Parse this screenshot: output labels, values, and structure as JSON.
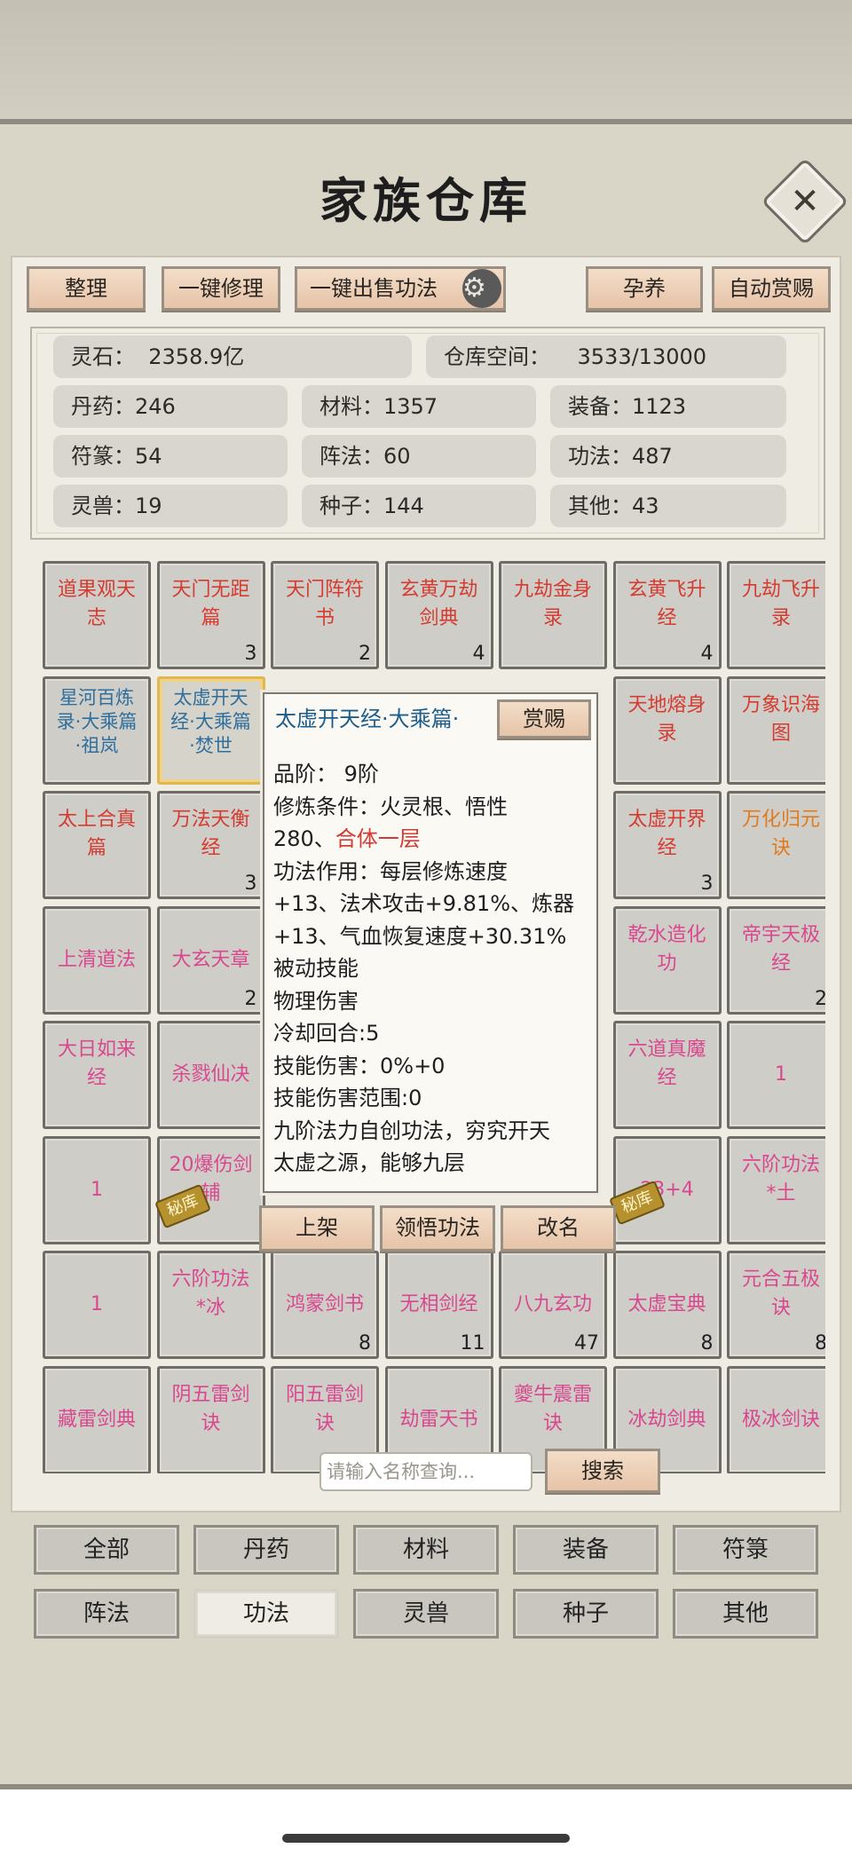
{
  "title": "家族仓库",
  "toolbar": {
    "sort": "整理",
    "repair": "一键修理",
    "sell": "一键出售功法",
    "nurture": "孕养",
    "auto_reward": "自动赏赐"
  },
  "stats": {
    "spirit_stone": "灵石：  2358.9亿",
    "space": "仓库空间：    3533/13000",
    "pills": "丹药：246",
    "materials": "材料：1357",
    "equipment": "装备：1123",
    "talismans": "符篆：54",
    "formations": "阵法：60",
    "techniques": "功法：487",
    "beasts": "灵兽：19",
    "seeds": "种子：144",
    "others": "其他：43"
  },
  "grid": [
    {
      "name": "道果观天\n志",
      "count": "",
      "color": "#d53b30"
    },
    {
      "name": "天门无距\n篇",
      "count": "3",
      "color": "#d53b30"
    },
    {
      "name": "天门阵符\n书",
      "count": "2",
      "color": "#d53b30"
    },
    {
      "name": "玄黄万劫\n剑典",
      "count": "4",
      "color": "#d53b30"
    },
    {
      "name": "九劫金身\n录",
      "count": "",
      "color": "#d53b30"
    },
    {
      "name": "玄黄飞升\n经",
      "count": "4",
      "color": "#d53b30"
    },
    {
      "name": "九劫飞升\n录",
      "count": "",
      "color": "#d53b30"
    },
    {
      "name": "星河百炼\n录·大乘篇\n·祖岚",
      "count": "",
      "color": "#2f6f9e",
      "small": true
    },
    {
      "name": "太虚开天\n经·大乘篇\n·焚世",
      "count": "",
      "color": "#2f6f9e",
      "small": true,
      "selected": true
    },
    null,
    null,
    null,
    {
      "name": "天地熔身\n录",
      "count": "",
      "color": "#d53b30"
    },
    {
      "name": "万象识海\n图",
      "count": "",
      "color": "#d53b30"
    },
    {
      "name": "太上合真\n篇",
      "count": "",
      "color": "#d53b30"
    },
    {
      "name": "万法天衡\n经",
      "count": "3",
      "color": "#d53b30"
    },
    null,
    null,
    null,
    {
      "name": "太虚开界\n经",
      "count": "3",
      "color": "#d53b30"
    },
    {
      "name": "万化归元\n诀",
      "count": "",
      "color": "#e07a1f"
    },
    {
      "name": "上清道法",
      "count": "",
      "color": "#d9488e"
    },
    {
      "name": "大玄天章",
      "count": "2",
      "color": "#d9488e"
    },
    null,
    null,
    null,
    {
      "name": "乾水造化\n功",
      "count": "",
      "color": "#d9488e"
    },
    {
      "name": "帝宇天极\n经",
      "count": "2",
      "color": "#d9488e"
    },
    {
      "name": "大日如来\n经",
      "count": "",
      "color": "#d9488e"
    },
    {
      "name": "杀戮仙决",
      "count": "",
      "color": "#d9488e"
    },
    null,
    null,
    null,
    {
      "name": "六道真魔\n经",
      "count": "",
      "color": "#d9488e"
    },
    {
      "name": "1",
      "count": "",
      "color": "#d9488e"
    },
    {
      "name": "1",
      "count": "",
      "color": "#d9488e"
    },
    {
      "name": "20爆伤剑\n辅",
      "count": "",
      "color": "#d9488e",
      "seal": true
    },
    null,
    null,
    null,
    {
      "name": "23+4",
      "count": "",
      "color": "#d9488e",
      "seal": true
    },
    {
      "name": "六阶功法\n*土",
      "count": "",
      "color": "#d9488e"
    },
    {
      "name": "1",
      "count": "",
      "color": "#d9488e"
    },
    {
      "name": "六阶功法\n*冰",
      "count": "",
      "color": "#d9488e"
    },
    {
      "name": "鸿蒙剑书",
      "count": "8",
      "color": "#d9488e"
    },
    {
      "name": "无相剑经",
      "count": "11",
      "color": "#d9488e"
    },
    {
      "name": "八九玄功",
      "count": "47",
      "color": "#d9488e"
    },
    {
      "name": "太虚宝典",
      "count": "8",
      "color": "#d9488e"
    },
    {
      "name": "元合五极\n诀",
      "count": "8",
      "color": "#d9488e"
    },
    {
      "name": "藏雷剑典",
      "count": "",
      "color": "#d9488e"
    },
    {
      "name": "阴五雷剑\n诀",
      "count": "",
      "color": "#d9488e"
    },
    {
      "name": "阳五雷剑\n诀",
      "count": "",
      "color": "#d9488e"
    },
    {
      "name": "劫雷天书",
      "count": "",
      "color": "#d9488e"
    },
    {
      "name": "夔牛震雷\n诀",
      "count": "",
      "color": "#d9488e"
    },
    {
      "name": "冰劫剑典",
      "count": "",
      "color": "#d9488e"
    },
    {
      "name": "极冰剑诀",
      "count": "",
      "color": "#d9488e"
    }
  ],
  "seal_label": "秘库",
  "popup": {
    "title": "太虚开天经·大乘篇·",
    "reward": "赏赐",
    "grade": "品阶：  9阶",
    "req": "修炼条件：火灵根、悟性",
    "req2_a": "280、",
    "req2_b": "合体一层",
    "effect1": "功法作用：每层修炼速度",
    "effect2": "+13、法术攻击+9.81%、炼器",
    "effect3": "+13、气血恢复速度+30.31%",
    "passive": "被动技能",
    "dmg_type": "物理伤害",
    "cooldown": "冷却回合:5",
    "skill_dmg": "技能伤害：0%+0",
    "skill_range": "技能伤害范围:0",
    "desc1": "九阶法力自创功法，穷究开天",
    "desc2": "太虚之源，能够九层"
  },
  "actions": {
    "list": "上架",
    "learn": "领悟功法",
    "rename": "改名"
  },
  "search": {
    "placeholder": "请输入名称查询...",
    "button": "搜索"
  },
  "categories": [
    "全部",
    "丹药",
    "材料",
    "装备",
    "符箓",
    "阵法",
    "功法",
    "灵兽",
    "种子",
    "其他"
  ],
  "active_category": "功法",
  "icons": {
    "close": "close-icon",
    "gear": "gear-icon",
    "seal": "seal-icon"
  }
}
